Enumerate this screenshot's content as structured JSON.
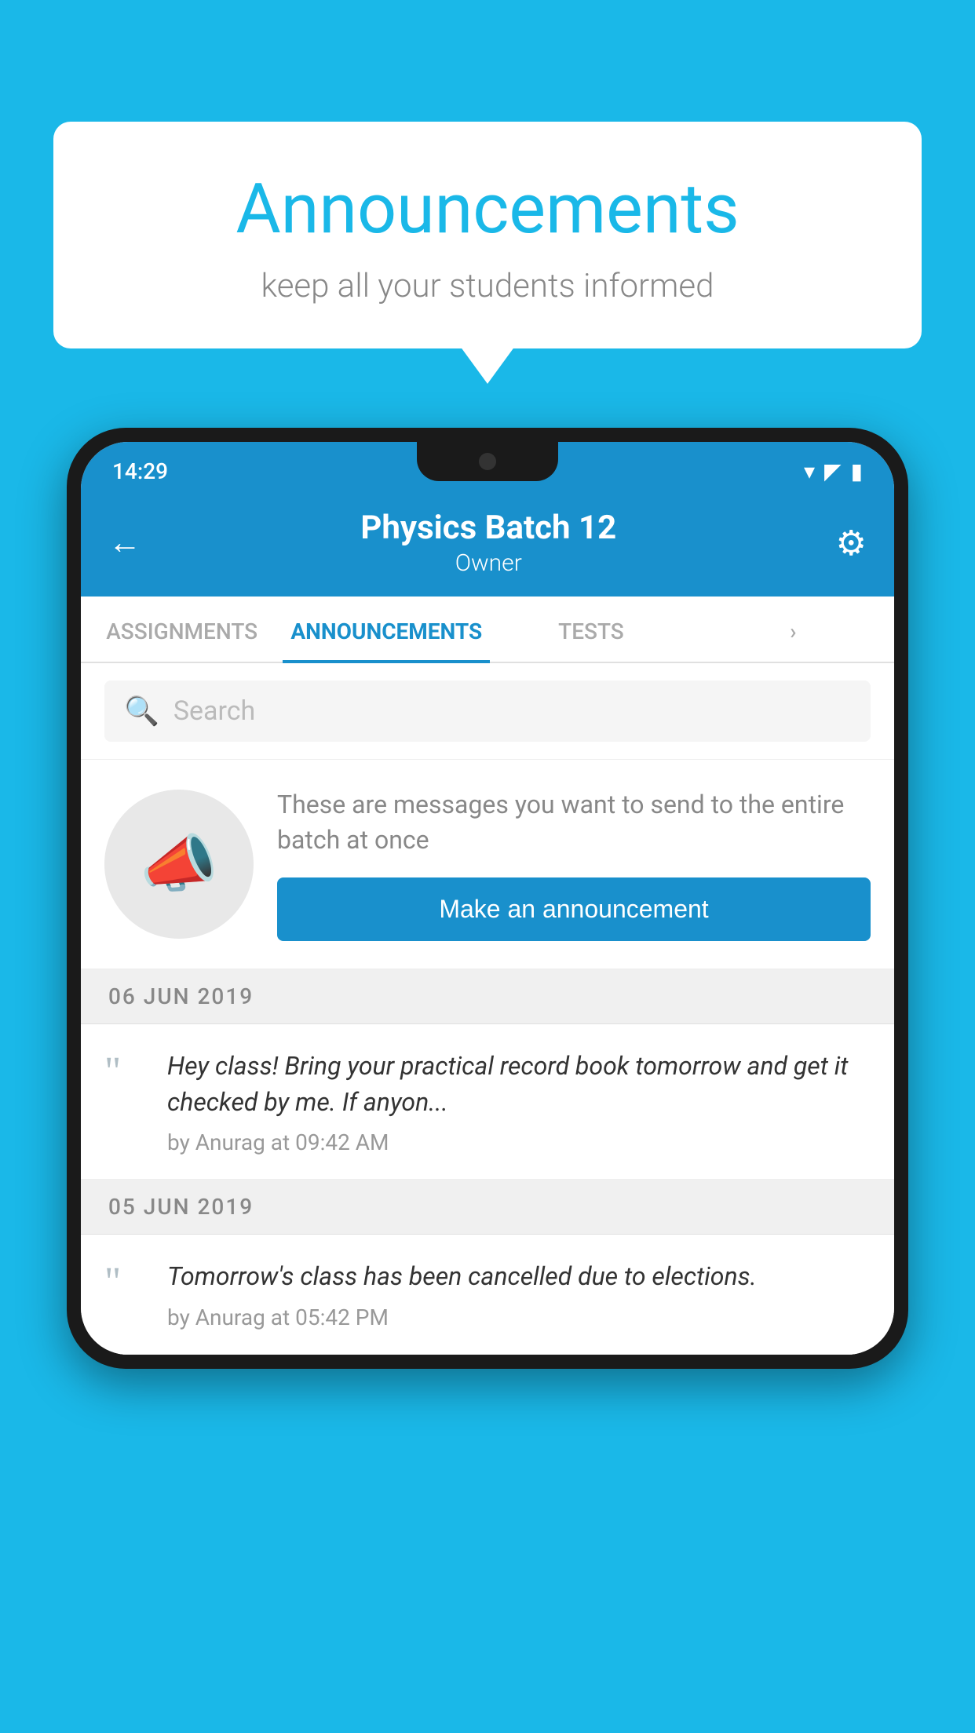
{
  "bubble": {
    "title": "Announcements",
    "subtitle": "keep all your students informed"
  },
  "statusBar": {
    "time": "14:29",
    "wifi": "▾",
    "signal": "▲",
    "battery": "▮"
  },
  "header": {
    "title": "Physics Batch 12",
    "subtitle": "Owner",
    "backLabel": "←",
    "settingsLabel": "⚙"
  },
  "tabs": [
    {
      "label": "ASSIGNMENTS",
      "active": false
    },
    {
      "label": "ANNOUNCEMENTS",
      "active": true
    },
    {
      "label": "TESTS",
      "active": false
    },
    {
      "label": "›",
      "active": false
    }
  ],
  "search": {
    "placeholder": "Search"
  },
  "announcementPrompt": {
    "description": "These are messages you want to send to the entire batch at once",
    "buttonLabel": "Make an announcement"
  },
  "announcements": [
    {
      "date": "06  JUN  2019",
      "text": "Hey class! Bring your practical record book tomorrow and get it checked by me. If anyon...",
      "meta": "by Anurag at 09:42 AM"
    },
    {
      "date": "05  JUN  2019",
      "text": "Tomorrow's class has been cancelled due to elections.",
      "meta": "by Anurag at 05:42 PM"
    }
  ]
}
